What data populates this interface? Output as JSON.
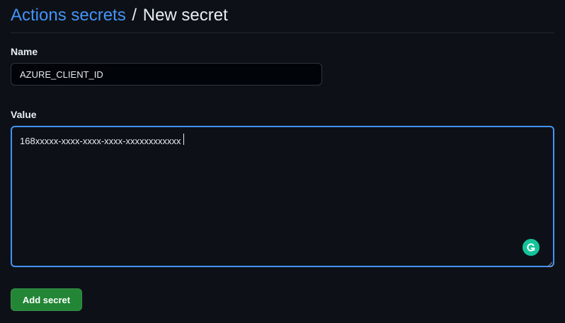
{
  "header": {
    "breadcrumb_link": "Actions secrets",
    "separator": "/",
    "current": "New secret"
  },
  "form": {
    "name_label": "Name",
    "name_value": "AZURE_CLIENT_ID",
    "value_label": "Value",
    "value_text": "168xxxxx-xxxx-xxxx-xxxx-xxxxxxxxxxxx",
    "submit_label": "Add secret"
  },
  "icons": {
    "grammarly": "grammarly-icon",
    "resize": "resize-handle-icon"
  },
  "colors": {
    "background": "#0d1117",
    "link": "#4493f8",
    "focus_border": "#4493f8",
    "button": "#238636",
    "grammarly": "#15c39a"
  }
}
